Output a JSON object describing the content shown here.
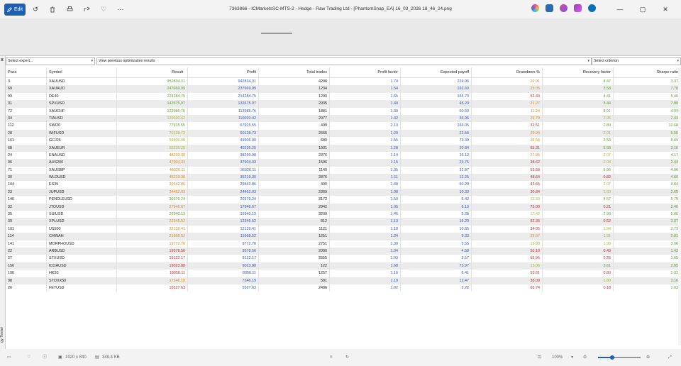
{
  "titlebar": {
    "edit_label": "Edit",
    "title": "7363866 - ICMarketsSC-MTS-2 - Hedge - Raw Trading Ltd - [PhantomSnap_EA] 16_03_2026 18_46_24.png",
    "icons": [
      "rotate-left-icon",
      "delete-icon",
      "print-icon",
      "share-icon",
      "favorite-icon",
      "more-icon"
    ],
    "window_controls": [
      "minimize-icon",
      "maximize-icon",
      "close-icon"
    ]
  },
  "filters": {
    "expert": "Select expert...",
    "results": "View previous optimization results",
    "criterion": "Select criterion"
  },
  "side": {
    "close": "x",
    "vertical_label": "gy Tester"
  },
  "columns": [
    "Pass",
    "Symbol",
    "Result",
    "Profit",
    "Total trades",
    "Profit factor",
    "Expected payoff",
    "Drawdown %",
    "Recovery factor",
    "Sharpe ratio"
  ],
  "sort_indicator": "▾",
  "colors": {
    "blue": "#2a57c9",
    "green": "#5aa02c",
    "orange": "#d98a1a",
    "red": "#c62828",
    "yellowgreen": "#a8b52a",
    "accent": "#1e5fb4"
  },
  "rows": [
    {
      "pass": "3",
      "symbol": "XAUUSD",
      "result": "952834.31",
      "profit": "942834.31",
      "trades": "4208",
      "pf": "1.74",
      "ep": "224.06",
      "dd": "26.91",
      "rf": "4.47",
      "sr": "3.37",
      "rc": "green",
      "dc": "orange",
      "rfc": "green",
      "src": "green"
    },
    {
      "pass": "69",
      "symbol": "XAUAUD",
      "result": "247669.99",
      "profit": "237669.99",
      "trades": "1234",
      "pf": "1.54",
      "ep": "192.60",
      "dd": "25.05",
      "rf": "3.58",
      "sr": "7.78",
      "rc": "green",
      "dc": "orange",
      "rfc": "green",
      "src": "green"
    },
    {
      "pass": "93",
      "symbol": "DE40",
      "result": "224284.75",
      "profit": "214284.75",
      "trades": "1293",
      "pf": "1.65",
      "ep": "165.73",
      "dd": "52.43",
      "rf": "4.41",
      "sr": "5.40",
      "rc": "green",
      "dc": "red",
      "rfc": "green",
      "src": "green"
    },
    {
      "pass": "31",
      "symbol": "SPXUSD",
      "result": "142675.97",
      "profit": "132675.97",
      "trades": "2935",
      "pf": "1.40",
      "ep": "45.20",
      "dd": "21.27",
      "rf": "3.44",
      "sr": "7.98",
      "rc": "green",
      "dc": "orange",
      "rfc": "green",
      "src": "green"
    },
    {
      "pass": "72",
      "symbol": "XAUCHF",
      "result": "123985.76",
      "profit": "113985.76",
      "trades": "1881",
      "pf": "1.39",
      "ep": "60.60",
      "dd": "11.24",
      "rf": "8.01",
      "sr": "4.94",
      "rc": "green",
      "dc": "orange",
      "rfc": "green",
      "src": "green"
    },
    {
      "pass": "34",
      "symbol": "TIAUSD",
      "result": "120020.42",
      "profit": "110020.42",
      "trades": "2977",
      "pf": "1.42",
      "ep": "36.96",
      "dd": "23.79",
      "rf": "2.95",
      "sr": "7.44",
      "rc": "yellowgreen",
      "dc": "orange",
      "rfc": "yellowgreen",
      "src": "green"
    },
    {
      "pass": "112",
      "symbol": "SWI20",
      "result": "77915.55",
      "profit": "67915.55",
      "trades": "409",
      "pf": "2.13",
      "ep": "166.05",
      "dd": "32.51",
      "rf": "2.80",
      "sr": "12.68",
      "rc": "green",
      "dc": "red",
      "rfc": "green",
      "src": "green"
    },
    {
      "pass": "28",
      "symbol": "WIFUSD",
      "result": "70128.73",
      "profit": "60128.73",
      "trades": "2665",
      "pf": "1.20",
      "ep": "22.56",
      "dd": "29.94",
      "rf": "2.01",
      "sr": "5.56",
      "rc": "yellowgreen",
      "dc": "orange",
      "rfc": "yellowgreen",
      "src": "green"
    },
    {
      "pass": "161",
      "symbol": "GCJ26",
      "result": "59906.00",
      "profit": "49906.00",
      "trades": "680",
      "pf": "1.55",
      "ep": "73.39",
      "dd": "26.56",
      "rf": "3.53",
      "sr": "8.69",
      "rc": "yellowgreen",
      "dc": "orange",
      "rfc": "green",
      "src": "green"
    },
    {
      "pass": "68",
      "symbol": "XAUEUR",
      "result": "50235.25",
      "profit": "40235.25",
      "trades": "1931",
      "pf": "1.28",
      "ep": "20.84",
      "dd": "65.31",
      "rf": "5.68",
      "sr": "3.16",
      "rc": "yellowgreen",
      "dc": "red",
      "rfc": "green",
      "src": "green"
    },
    {
      "pass": "24",
      "symbol": "ENAUSD",
      "result": "48299.98",
      "profit": "38299.98",
      "trades": "2376",
      "pf": "1.14",
      "ep": "16.12",
      "dd": "27.95",
      "rf": "2.07",
      "sr": "4.17",
      "rc": "orange",
      "dc": "orange",
      "rfc": "yellowgreen",
      "src": "green"
    },
    {
      "pass": "96",
      "symbol": "AUS200",
      "result": "47904.33",
      "profit": "37904.33",
      "trades": "1596",
      "pf": "1.15",
      "ep": "23.75",
      "dd": "38.62",
      "rf": "2.04",
      "sr": "2.44",
      "rc": "orange",
      "dc": "red",
      "rfc": "yellowgreen",
      "src": "green"
    },
    {
      "pass": "71",
      "symbol": "XAUGBP",
      "result": "46326.11",
      "profit": "36326.11",
      "trades": "1140",
      "pf": "1.35",
      "ep": "31.87",
      "dd": "53.58",
      "rf": "5.96",
      "sr": "4.96",
      "rc": "orange",
      "dc": "red",
      "rfc": "green",
      "src": "green"
    },
    {
      "pass": "30",
      "symbol": "WLDUSD",
      "result": "45219.30",
      "profit": "35219.30",
      "trades": "2876",
      "pf": "1.11",
      "ep": "12.25",
      "dd": "48.64",
      "rf": "0.82",
      "sr": "4.60",
      "rc": "orange",
      "dc": "red",
      "rfc": "red",
      "src": "green"
    },
    {
      "pass": "104",
      "symbol": "ES35",
      "result": "39542.86",
      "profit": "29542.86",
      "trades": "490",
      "pf": "1.48",
      "ep": "60.29",
      "dd": "43.65",
      "rf": "2.07",
      "sr": "3.84",
      "rc": "orange",
      "dc": "red",
      "rfc": "yellowgreen",
      "src": "green"
    },
    {
      "pass": "23",
      "symbol": "JUPUSD",
      "result": "34462.03",
      "profit": "24462.03",
      "trades": "2369",
      "pf": "1.08",
      "ep": "10.33",
      "dd": "30.84",
      "rf": "1.60",
      "sr": "2.65",
      "rc": "orange",
      "dc": "red",
      "rfc": "yellowgreen",
      "src": "green"
    },
    {
      "pass": "146",
      "symbol": "PENDLEUSD",
      "result": "30379.24",
      "profit": "20379.24",
      "trades": "3172",
      "pf": "1.59",
      "ep": "6.42",
      "dd": "12.33",
      "rf": "4.57",
      "sr": "5.79",
      "rc": "green",
      "dc": "yellowgreen",
      "rfc": "green",
      "src": "green"
    },
    {
      "pass": "32",
      "symbol": "JTOUSD",
      "result": "27946.67",
      "profit": "17946.67",
      "trades": "2942",
      "pf": "1.05",
      "ep": "6.10",
      "dd": "75.00",
      "rf": "0.21",
      "sr": "2.40",
      "rc": "orange",
      "dc": "red",
      "rfc": "red",
      "src": "green"
    },
    {
      "pass": "35",
      "symbol": "SUIUSD",
      "result": "26940.13",
      "profit": "16940.13",
      "trades": "3209",
      "pf": "1.46",
      "ep": "5.28",
      "dd": "17.42",
      "rf": "2.99",
      "sr": "5.06",
      "rc": "green",
      "dc": "yellowgreen",
      "rfc": "green",
      "src": "green"
    },
    {
      "pass": "39",
      "symbol": "XPLUSD",
      "result": "22345.52",
      "profit": "12345.52",
      "trades": "812",
      "pf": "1.13",
      "ep": "15.20",
      "dd": "52.36",
      "rf": "0.52",
      "sr": "3.07",
      "rc": "orange",
      "dc": "red",
      "rfc": "red",
      "src": "green"
    },
    {
      "pass": "101",
      "symbol": "US500",
      "result": "22139.41",
      "profit": "12139.41",
      "trades": "1121",
      "pf": "1.18",
      "ep": "10.85",
      "dd": "34.05",
      "rf": "1.94",
      "sr": "2.73",
      "rc": "orange",
      "dc": "red",
      "rfc": "yellowgreen",
      "src": "green"
    },
    {
      "pass": "114",
      "symbol": "CHINAH",
      "result": "21668.52",
      "profit": "11668.52",
      "trades": "1251",
      "pf": "1.24",
      "ep": "9.33",
      "dd": "25.67",
      "rf": "1.91",
      "sr": "2.81",
      "rc": "orange",
      "dc": "orange",
      "rfc": "yellowgreen",
      "src": "green"
    },
    {
      "pass": "141",
      "symbol": "MORPHOUSD",
      "result": "19772.70",
      "profit": "9772.70",
      "trades": "2751",
      "pf": "1.30",
      "ep": "3.55",
      "dd": "19.99",
      "rf": "1.99",
      "sr": "3.06",
      "rc": "orange",
      "dc": "yellowgreen",
      "rfc": "yellowgreen",
      "src": "green"
    },
    {
      "pass": "22",
      "symbol": "ARBUSD",
      "result": "19578.56",
      "profit": "9578.56",
      "trades": "2090",
      "pf": "1.04",
      "ep": "4.58",
      "dd": "50.10",
      "rf": "0.49",
      "sr": "1.43",
      "rc": "red",
      "dc": "red",
      "rfc": "red",
      "src": "green"
    },
    {
      "pass": "27",
      "symbol": "STXUSD",
      "result": "19122.17",
      "profit": "9122.17",
      "trades": "2555",
      "pf": "1.03",
      "ep": "3.57",
      "dd": "65.96",
      "rf": "0.25",
      "sr": "1.65",
      "rc": "red",
      "dc": "red",
      "rfc": "red",
      "src": "green"
    },
    {
      "pass": "156",
      "symbol": "ICOAUSD",
      "result": "19023.88",
      "profit": "9023.88",
      "trades": "122",
      "pf": "1.68",
      "ep": "73.97",
      "dd": "13.06",
      "rf": "3.61",
      "sr": "2.95",
      "rc": "red",
      "dc": "yellowgreen",
      "rfc": "green",
      "src": "green"
    },
    {
      "pass": "106",
      "symbol": "HK50",
      "result": "18058.11",
      "profit": "8058.11",
      "trades": "1257",
      "pf": "1.16",
      "ep": "6.41",
      "dd": "53.61",
      "rf": "0.80",
      "sr": "1.02",
      "rc": "red",
      "dc": "red",
      "rfc": "red",
      "src": "green"
    },
    {
      "pass": "98",
      "symbol": "STOXX50",
      "result": "17246.19",
      "profit": "7246.19",
      "trades": "581",
      "pf": "1.19",
      "ep": "12.47",
      "dd": "38.09",
      "rf": "1.80",
      "sr": "3.16",
      "rc": "orange",
      "dc": "red",
      "rfc": "yellowgreen",
      "src": "green"
    },
    {
      "pass": "26",
      "symbol": "FETUSD",
      "result": "15527.63",
      "profit": "5527.63",
      "trades": "2486",
      "pf": "1.02",
      "ep": "2.22",
      "dd": "66.74",
      "rf": "0.18",
      "sr": "1.03",
      "rc": "red",
      "dc": "red",
      "rfc": "red",
      "src": "green"
    }
  ],
  "statusbar": {
    "dimensions": "1920 x 840",
    "filesize": "349.4 KB",
    "zoom": "100%",
    "zoom_fraction": 0.33
  }
}
